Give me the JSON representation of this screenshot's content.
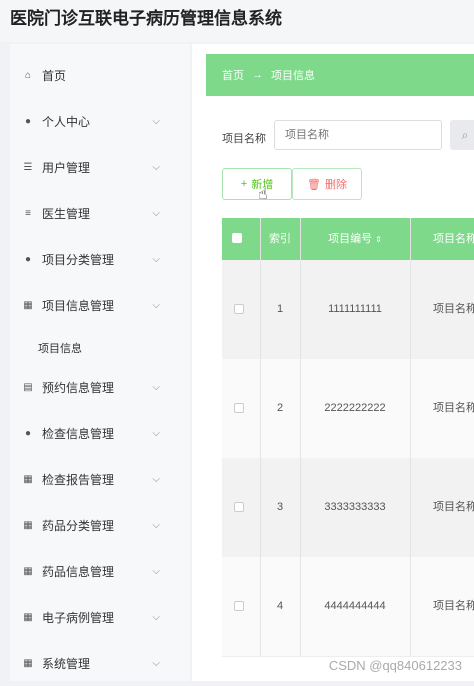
{
  "app": {
    "title": "医院门诊互联电子病历管理信息系统"
  },
  "sidebar": {
    "items": [
      {
        "label": "首页",
        "icon": "home-icon",
        "glyph": "⌂",
        "has_chevron": false
      },
      {
        "label": "个人中心",
        "icon": "user-icon",
        "glyph": "●",
        "has_chevron": true
      },
      {
        "label": "用户管理",
        "icon": "sliders-icon",
        "glyph": "☰",
        "has_chevron": true
      },
      {
        "label": "医生管理",
        "icon": "list-icon",
        "glyph": "≡",
        "has_chevron": true
      },
      {
        "label": "项目分类管理",
        "icon": "bulb-icon",
        "glyph": "●",
        "has_chevron": true
      },
      {
        "label": "项目信息管理",
        "icon": "grid-icon",
        "glyph": "▦",
        "has_chevron": true
      },
      {
        "label": "预约信息管理",
        "icon": "document-icon",
        "glyph": "▤",
        "has_chevron": true
      },
      {
        "label": "检查信息管理",
        "icon": "user-icon",
        "glyph": "●",
        "has_chevron": true
      },
      {
        "label": "检查报告管理",
        "icon": "grid-icon",
        "glyph": "▦",
        "has_chevron": true
      },
      {
        "label": "药品分类管理",
        "icon": "grid-icon",
        "glyph": "▦",
        "has_chevron": true
      },
      {
        "label": "药品信息管理",
        "icon": "grid-icon",
        "glyph": "▦",
        "has_chevron": true
      },
      {
        "label": "电子病例管理",
        "icon": "grid-icon",
        "glyph": "▦",
        "has_chevron": true
      },
      {
        "label": "系统管理",
        "icon": "grid-icon",
        "glyph": "▦",
        "has_chevron": true
      }
    ],
    "sub_item": "项目信息"
  },
  "breadcrumb": {
    "home": "首页",
    "arrow": "→",
    "current": "项目信息"
  },
  "search": {
    "label": "项目名称",
    "placeholder": "项目名称"
  },
  "toolbar": {
    "add_label": "新增",
    "delete_label": "删除"
  },
  "table": {
    "headers": [
      "索引",
      "项目编号",
      "项目名称"
    ],
    "rows": [
      {
        "index": "1",
        "code": "1111111111",
        "name": "项目名称"
      },
      {
        "index": "2",
        "code": "2222222222",
        "name": "项目名称"
      },
      {
        "index": "3",
        "code": "3333333333",
        "name": "项目名称"
      },
      {
        "index": "4",
        "code": "4444444444",
        "name": "项目名称"
      }
    ]
  },
  "watermark": "CSDN @qq840612233",
  "colors": {
    "accent": "#7ed98a",
    "danger": "#f56c6c"
  }
}
